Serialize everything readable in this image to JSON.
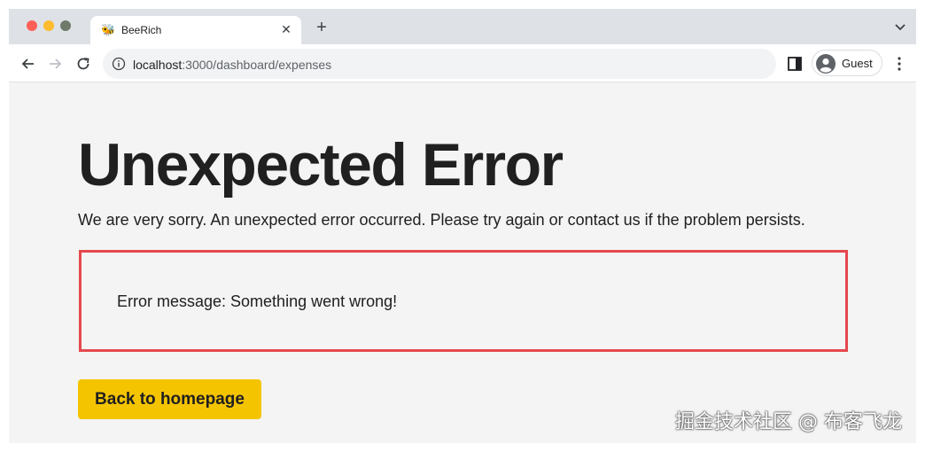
{
  "browser": {
    "tab_title": "BeeRich",
    "tab_favicon": "bee-icon",
    "url_host": "localhost",
    "url_path": ":3000/dashboard/expenses",
    "profile_label": "Guest",
    "traffic_colors": {
      "close": "#ff5f57",
      "minimize": "#febc2e",
      "maximize": "#6f7a6b"
    }
  },
  "page": {
    "title": "Unexpected Error",
    "subtitle": "We are very sorry. An unexpected error occurred. Please try again or contact us if the problem persists.",
    "error_message": "Error message: Something went wrong!",
    "back_button_label": "Back to homepage",
    "colors": {
      "error_border": "#e5484d",
      "button_bg": "#f5c400",
      "page_bg": "#f4f4f4"
    }
  },
  "watermark": "掘金技术社区 @ 布客飞龙"
}
